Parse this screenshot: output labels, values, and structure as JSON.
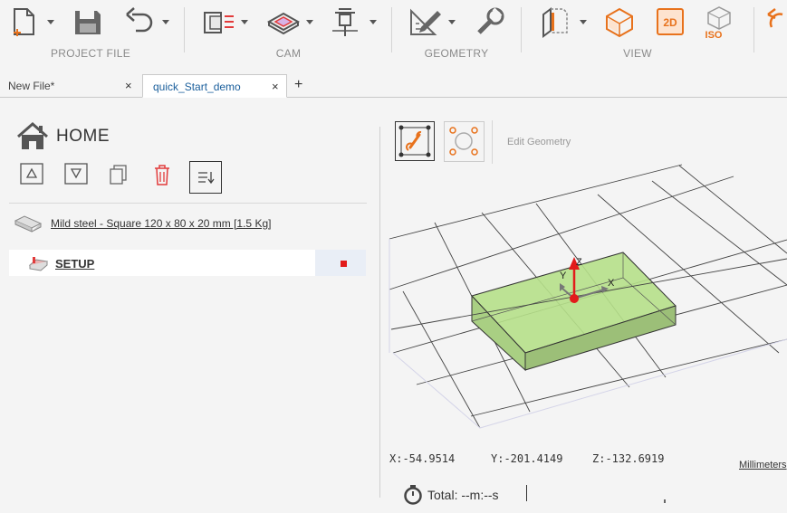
{
  "ribbon": {
    "groups": [
      {
        "label": "PROJECT FILE"
      },
      {
        "label": "CAM"
      },
      {
        "label": "GEOMETRY"
      },
      {
        "label": "VIEW"
      }
    ],
    "view_2d": "2D",
    "view_iso": "ISO"
  },
  "tabs": [
    {
      "label": "New File*",
      "close": "×"
    },
    {
      "label": "quick_Start_demo",
      "close": "×"
    }
  ],
  "tab_add": "+",
  "panel": {
    "home_title": "HOME",
    "stock_label": "Mild steel - Square 120 x 80 x 20 mm [1.5 Kg]",
    "setup_label": "SETUP"
  },
  "viewport": {
    "edit_geometry": "Edit Geometry",
    "axes": {
      "x": "X",
      "y": "Y",
      "z": "Z"
    },
    "coords": {
      "x": "X:-54.9514",
      "y": "Y:-201.4149",
      "z": "Z:-132.6919"
    },
    "units": "Millimeters",
    "total": "Total:  --m:--s"
  },
  "colors": {
    "accent_orange": "#e8721c",
    "accent_red": "#e23b3b",
    "stock_green": "#b6e08a",
    "link_blue": "#1b5f9c"
  }
}
